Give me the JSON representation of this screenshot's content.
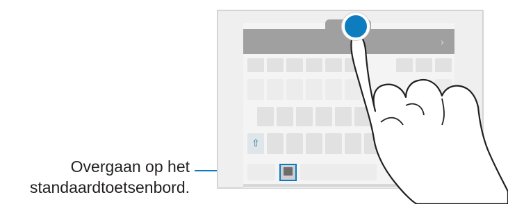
{
  "callout": {
    "line1": "Overgaan op het",
    "line2": "standaardtoetsenbord."
  },
  "illustration": {
    "device": "tablet-keyboard",
    "icons": [
      "shift-icon",
      "keyboard-handle-icon",
      "touch-point-icon",
      "finger-icon"
    ],
    "accent_color": "#0b7bc1"
  }
}
